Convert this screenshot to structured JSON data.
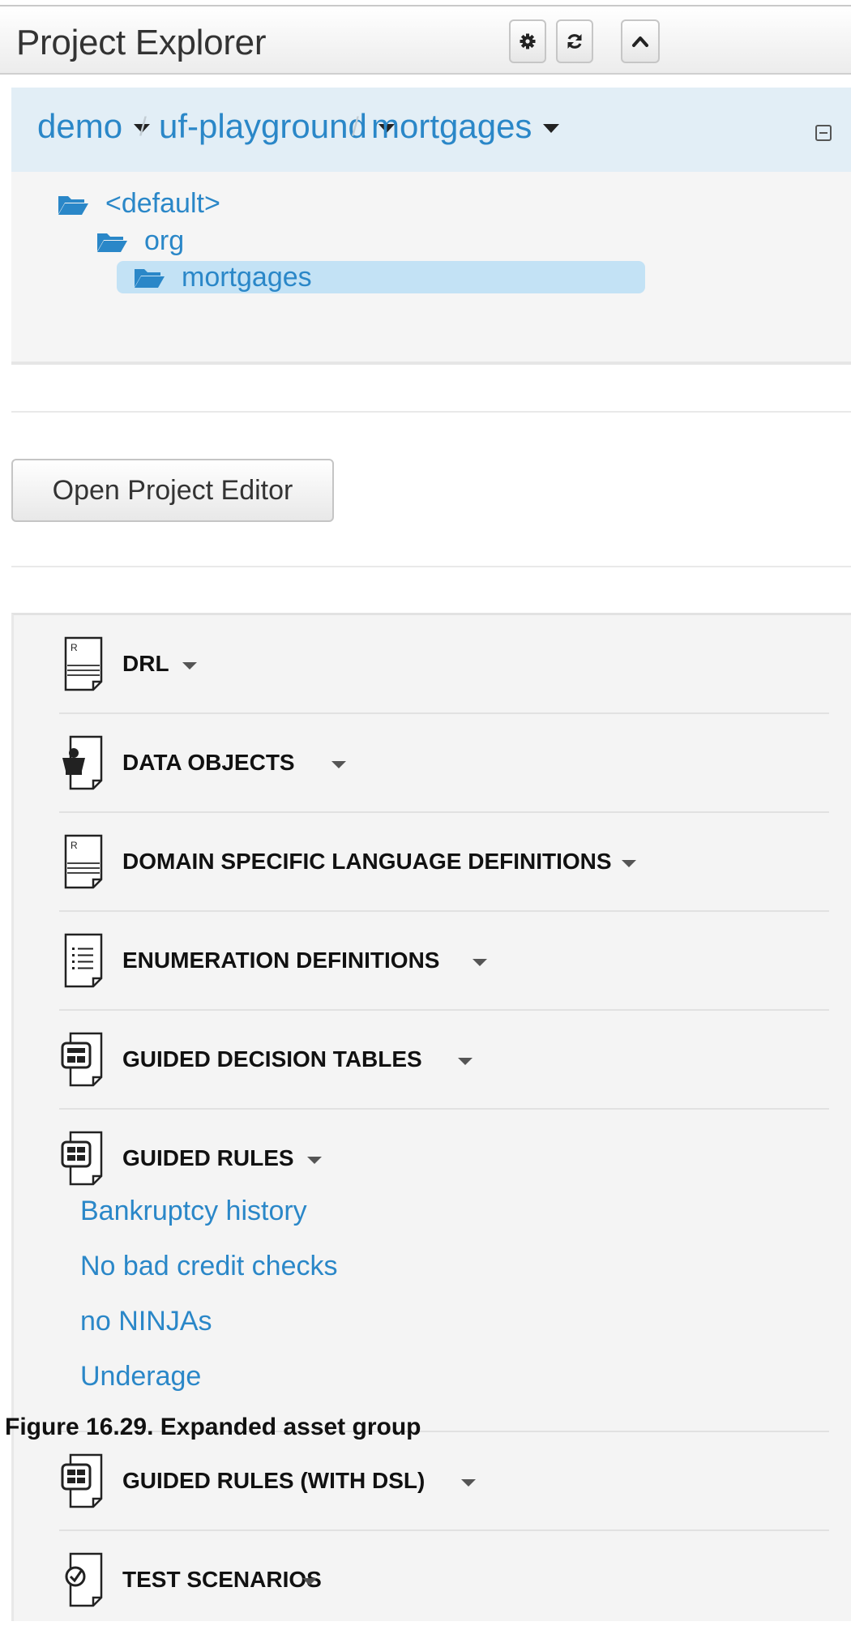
{
  "header": {
    "title": "Project Explorer",
    "buttons": [
      "settings",
      "refresh",
      "collapse-panel"
    ]
  },
  "breadcrumb": {
    "items": [
      {
        "label": "demo"
      },
      {
        "label": "uf-playground"
      },
      {
        "label": "mortgages"
      }
    ],
    "separator": "/"
  },
  "tree": {
    "nodes": [
      {
        "label": "<default>",
        "level": 0,
        "selected": false
      },
      {
        "label": "org",
        "level": 1,
        "selected": false
      },
      {
        "label": "mortgages",
        "level": 2,
        "selected": true
      }
    ]
  },
  "project_editor_button": "Open Project Editor",
  "asset_groups": [
    {
      "label": "DRL",
      "icon": "drl-file-icon"
    },
    {
      "label": "DATA OBJECTS",
      "icon": "data-object-file-icon"
    },
    {
      "label": "DOMAIN SPECIFIC LANGUAGE DEFINITIONS",
      "icon": "dsl-file-icon"
    },
    {
      "label": "ENUMERATION DEFINITIONS",
      "icon": "enumeration-file-icon"
    },
    {
      "label": "GUIDED DECISION TABLES",
      "icon": "decision-table-file-icon"
    },
    {
      "label": "GUIDED RULES",
      "icon": "guided-rule-file-icon",
      "expanded": true,
      "items": [
        "Bankruptcy history",
        "No bad credit checks",
        "no NINJAs",
        "Underage"
      ]
    },
    {
      "label": "GUIDED RULES (WITH DSL)",
      "icon": "guided-rule-dsl-file-icon"
    },
    {
      "label": "TEST SCENARIOS",
      "icon": "test-scenario-file-icon"
    }
  ],
  "caption": "Figure 16.29. Expanded asset group",
  "colors": {
    "link": "#2a87c8",
    "breadcrumb_bg": "#e2eef6",
    "selected_bg": "#c3e2f5",
    "panel_bg": "#f4f4f4"
  }
}
